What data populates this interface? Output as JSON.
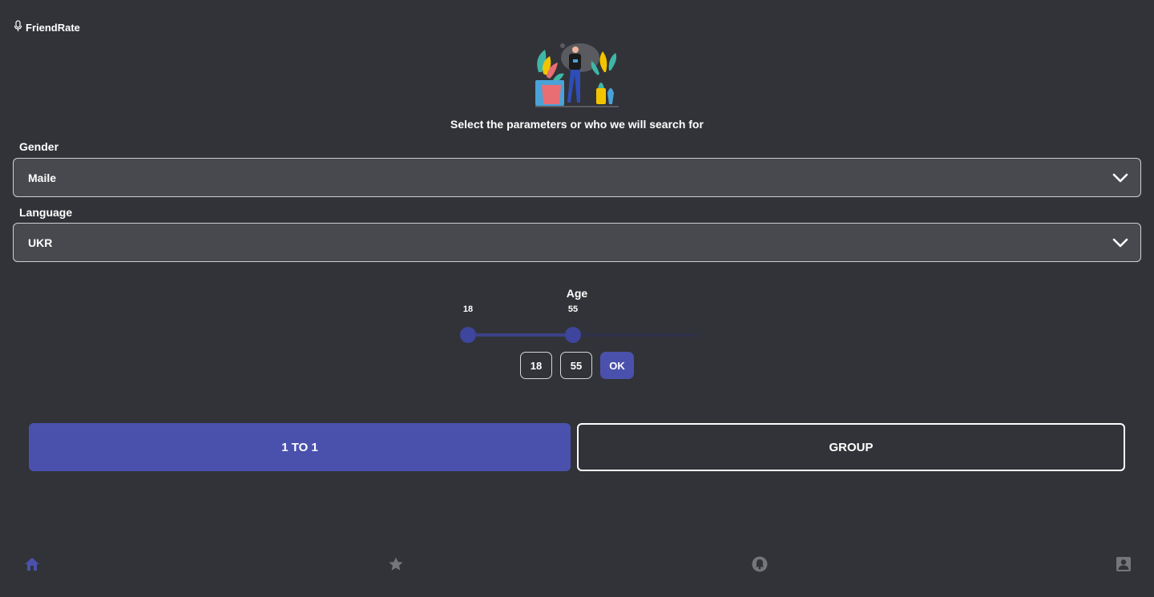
{
  "app": {
    "name": "FriendRate"
  },
  "main": {
    "subtitle": "Select the parameters or who we will search for",
    "gender": {
      "label": "Gender",
      "value": "Maile"
    },
    "language": {
      "label": "Language",
      "value": "UKR"
    },
    "age": {
      "label": "Age",
      "min": 18,
      "max": 55,
      "min_label": "18",
      "max_label": "55",
      "ok_label": "OK"
    },
    "modes": [
      {
        "label": "1 TO 1",
        "active": true
      },
      {
        "label": "GROUP",
        "active": false
      }
    ]
  },
  "bottom_nav": [
    {
      "icon": "home-icon",
      "active": true
    },
    {
      "icon": "star-icon",
      "active": false
    },
    {
      "icon": "bell-icon",
      "active": false
    },
    {
      "icon": "profile-icon",
      "active": false
    }
  ],
  "colors": {
    "background": "#323338",
    "accent": "#4a51ad",
    "field": "#48494e",
    "nav_active": "#4a51ad",
    "nav_inactive": "#75767b"
  }
}
